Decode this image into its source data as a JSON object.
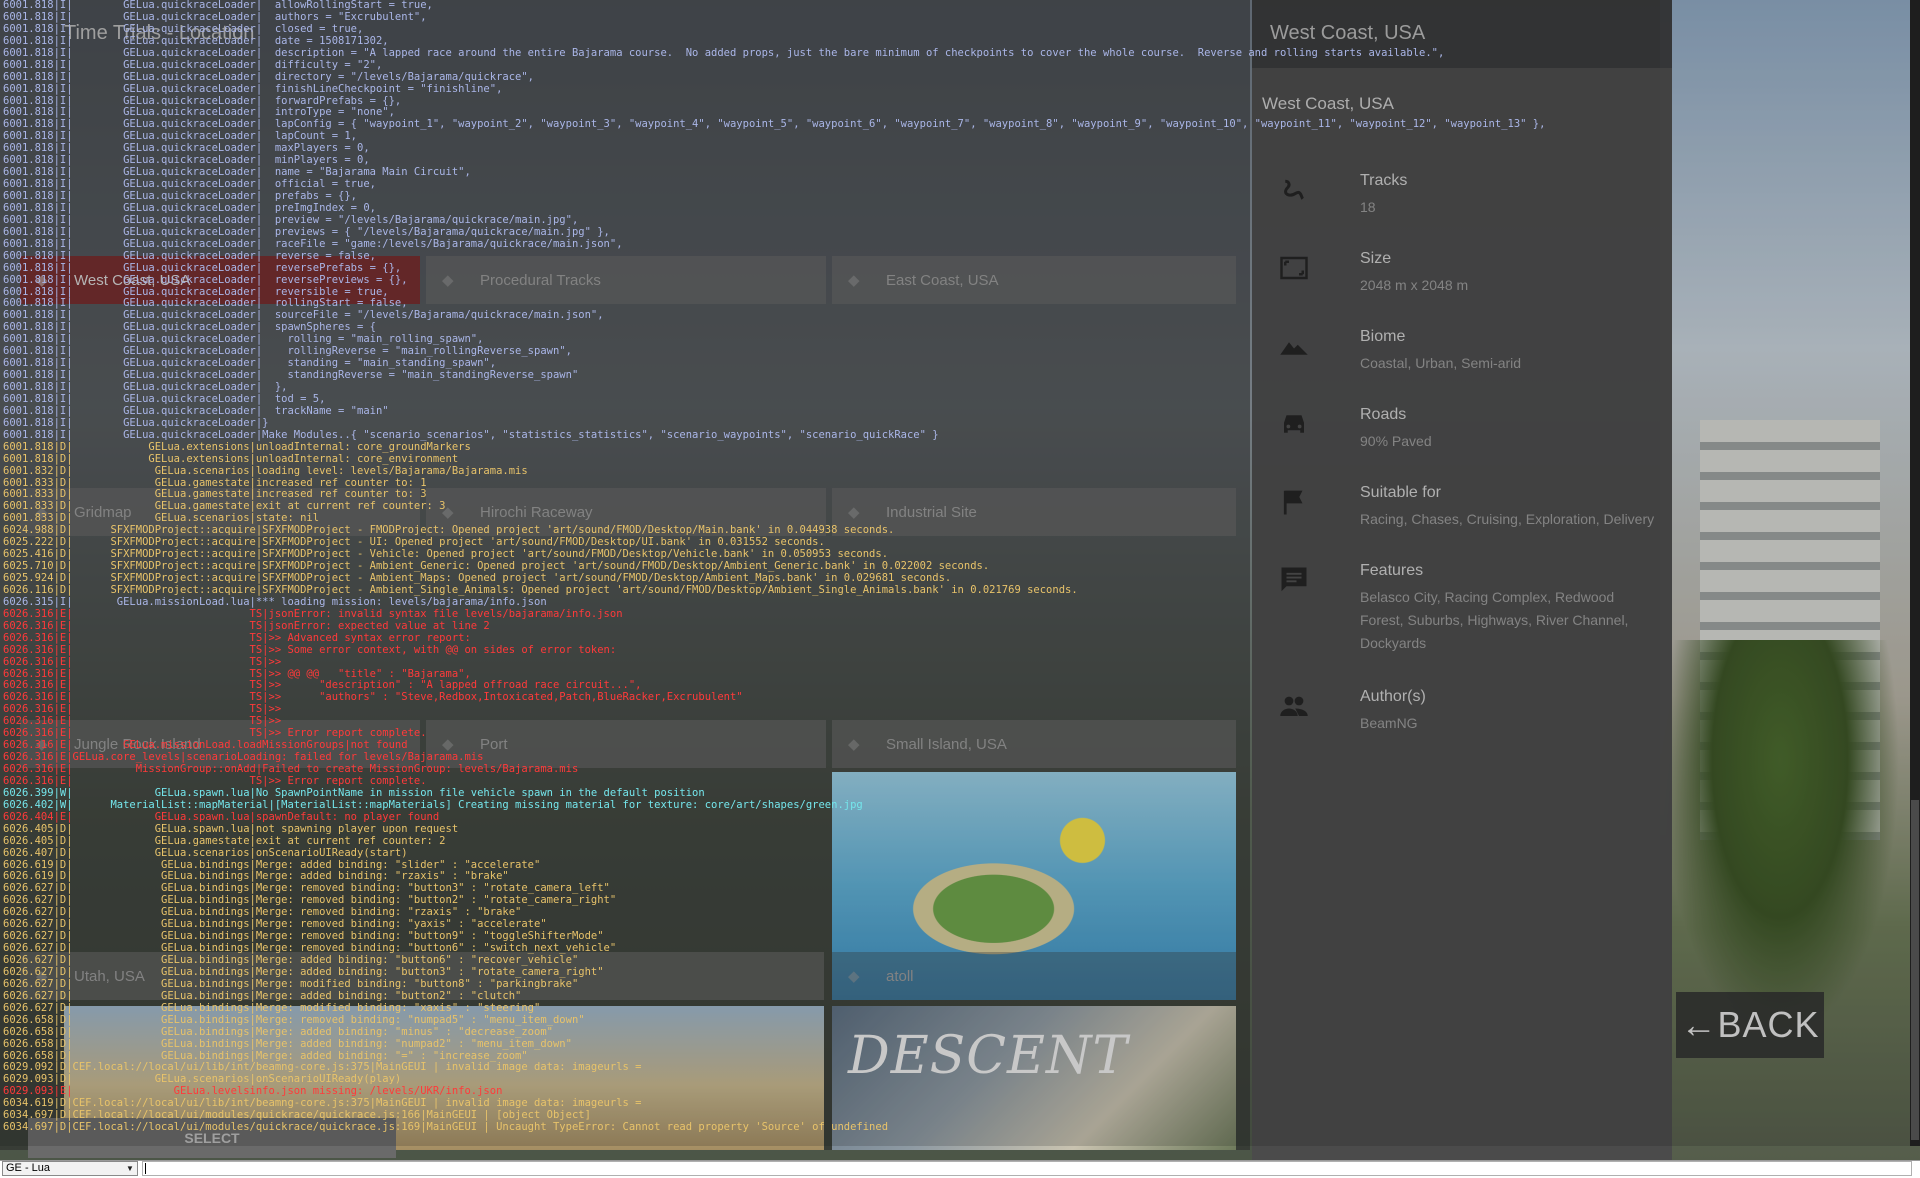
{
  "menu": {
    "heading": "Time Trials - Location",
    "tiles": [
      {
        "label": "West Coast, USA",
        "selected": true
      },
      {
        "label": "Procedural Tracks"
      },
      {
        "label": "East Coast, USA"
      },
      {
        "label": "Gridmap"
      },
      {
        "label": "Hirochi Raceway"
      },
      {
        "label": "Industrial Site"
      },
      {
        "label": "Jungle Rock Island"
      },
      {
        "label": "Port"
      },
      {
        "label": "Small Island, USA"
      },
      {
        "label": "Utah, USA"
      },
      {
        "label": "atoll"
      }
    ],
    "descent_art_text": "DESCENT"
  },
  "info_panel": {
    "header": "West Coast, USA",
    "card_title": "West Coast, USA",
    "specs": [
      {
        "icon": "track-squiggle-icon",
        "title": "Tracks",
        "value": "18"
      },
      {
        "icon": "map-size-icon",
        "title": "Size",
        "value": "2048 m x 2048 m"
      },
      {
        "icon": "mountain-icon",
        "title": "Biome",
        "value": "Coastal, Urban, Semi-arid"
      },
      {
        "icon": "car-icon",
        "title": "Roads",
        "value": "90% Paved"
      },
      {
        "icon": "flag-icon",
        "title": "Suitable for",
        "value": "Racing, Chases, Cruising, Exploration, Delivery"
      },
      {
        "icon": "comment-icon",
        "title": "Features",
        "value": "Belasco City, Racing Complex, Redwood Forest, Suburbs, Highways, River Channel, Dockyards"
      },
      {
        "icon": "people-icon",
        "title": "Author(s)",
        "value": "BeamNG"
      }
    ],
    "select_label": "SELECT"
  },
  "back_button": "←BACK",
  "console": {
    "context_selector": "GE - Lua",
    "command_placeholder": "",
    "lines": [
      {
        "level": "I",
        "text": "6001.818|I|        GELua.quickraceLoader|  allowRollingStart = true,"
      },
      {
        "level": "I",
        "text": "6001.818|I|        GELua.quickraceLoader|  authors = \"Excrubulent\","
      },
      {
        "level": "I",
        "text": "6001.818|I|        GELua.quickraceLoader|  closed = true,"
      },
      {
        "level": "I",
        "text": "6001.818|I|        GELua.quickraceLoader|  date = 1508171302,"
      },
      {
        "level": "I",
        "text": "6001.818|I|        GELua.quickraceLoader|  description = \"A lapped race around the entire Bajarama course.  No added props, just the bare minimum of checkpoints to cover the whole course.  Reverse and rolling starts available.\","
      },
      {
        "level": "I",
        "text": "6001.818|I|        GELua.quickraceLoader|  difficulty = \"2\","
      },
      {
        "level": "I",
        "text": "6001.818|I|        GELua.quickraceLoader|  directory = \"/levels/Bajarama/quickrace\","
      },
      {
        "level": "I",
        "text": "6001.818|I|        GELua.quickraceLoader|  finishLineCheckpoint = \"finishline\","
      },
      {
        "level": "I",
        "text": "6001.818|I|        GELua.quickraceLoader|  forwardPrefabs = {},"
      },
      {
        "level": "I",
        "text": "6001.818|I|        GELua.quickraceLoader|  introType = \"none\","
      },
      {
        "level": "I",
        "text": "6001.818|I|        GELua.quickraceLoader|  lapConfig = { \"waypoint_1\", \"waypoint_2\", \"waypoint_3\", \"waypoint_4\", \"waypoint_5\", \"waypoint_6\", \"waypoint_7\", \"waypoint_8\", \"waypoint_9\", \"waypoint_10\", \"waypoint_11\", \"waypoint_12\", \"waypoint_13\" },"
      },
      {
        "level": "I",
        "text": "6001.818|I|        GELua.quickraceLoader|  lapCount = 1,"
      },
      {
        "level": "I",
        "text": "6001.818|I|        GELua.quickraceLoader|  maxPlayers = 0,"
      },
      {
        "level": "I",
        "text": "6001.818|I|        GELua.quickraceLoader|  minPlayers = 0,"
      },
      {
        "level": "I",
        "text": "6001.818|I|        GELua.quickraceLoader|  name = \"Bajarama Main Circuit\","
      },
      {
        "level": "I",
        "text": "6001.818|I|        GELua.quickraceLoader|  official = true,"
      },
      {
        "level": "I",
        "text": "6001.818|I|        GELua.quickraceLoader|  prefabs = {},"
      },
      {
        "level": "I",
        "text": "6001.818|I|        GELua.quickraceLoader|  preImgIndex = 0,"
      },
      {
        "level": "I",
        "text": "6001.818|I|        GELua.quickraceLoader|  preview = \"/levels/Bajarama/quickrace/main.jpg\","
      },
      {
        "level": "I",
        "text": "6001.818|I|        GELua.quickraceLoader|  previews = { \"/levels/Bajarama/quickrace/main.jpg\" },"
      },
      {
        "level": "I",
        "text": "6001.818|I|        GELua.quickraceLoader|  raceFile = \"game:/levels/Bajarama/quickrace/main.json\","
      },
      {
        "level": "I",
        "text": "6001.818|I|        GELua.quickraceLoader|  reverse = false,"
      },
      {
        "level": "I",
        "text": "6001.818|I|        GELua.quickraceLoader|  reversePrefabs = {},"
      },
      {
        "level": "I",
        "text": "6001.818|I|        GELua.quickraceLoader|  reversePreviews = {},"
      },
      {
        "level": "I",
        "text": "6001.818|I|        GELua.quickraceLoader|  reversible = true,"
      },
      {
        "level": "I",
        "text": "6001.818|I|        GELua.quickraceLoader|  rollingStart = false,"
      },
      {
        "level": "I",
        "text": "6001.818|I|        GELua.quickraceLoader|  sourceFile = \"/levels/Bajarama/quickrace/main.json\","
      },
      {
        "level": "I",
        "text": "6001.818|I|        GELua.quickraceLoader|  spawnSpheres = {"
      },
      {
        "level": "I",
        "text": "6001.818|I|        GELua.quickraceLoader|    rolling = \"main_rolling_spawn\","
      },
      {
        "level": "I",
        "text": "6001.818|I|        GELua.quickraceLoader|    rollingReverse = \"main_rollingReverse_spawn\","
      },
      {
        "level": "I",
        "text": "6001.818|I|        GELua.quickraceLoader|    standing = \"main_standing_spawn\","
      },
      {
        "level": "I",
        "text": "6001.818|I|        GELua.quickraceLoader|    standingReverse = \"main_standingReverse_spawn\""
      },
      {
        "level": "I",
        "text": "6001.818|I|        GELua.quickraceLoader|  },"
      },
      {
        "level": "I",
        "text": "6001.818|I|        GELua.quickraceLoader|  tod = 5,"
      },
      {
        "level": "I",
        "text": "6001.818|I|        GELua.quickraceLoader|  trackName = \"main\""
      },
      {
        "level": "I",
        "text": "6001.818|I|        GELua.quickraceLoader|}"
      },
      {
        "level": "I",
        "text": "6001.818|I|        GELua.quickraceLoader|Make Modules..{ \"scenario_scenarios\", \"statistics_statistics\", \"scenario_waypoints\", \"scenario_quickRace\" }"
      },
      {
        "level": "D",
        "text": "6001.818|D|            GELua.extensions|unloadInternal: core_groundMarkers"
      },
      {
        "level": "D",
        "text": "6001.818|D|            GELua.extensions|unloadInternal: core_environment"
      },
      {
        "level": "D",
        "text": "6001.832|D|             GELua.scenarios|loading level: levels/Bajarama/Bajarama.mis"
      },
      {
        "level": "D",
        "text": "6001.833|D|             GELua.gamestate|increased ref counter to: 1"
      },
      {
        "level": "D",
        "text": "6001.833|D|             GELua.gamestate|increased ref counter to: 3"
      },
      {
        "level": "D",
        "text": "6001.833|D|             GELua.gamestate|exit at current ref counter: 3"
      },
      {
        "level": "D",
        "text": "6001.833|D|             GELua.scenarios|state: nil"
      },
      {
        "level": "D",
        "text": "6024.988|D|      SFXFMODProject::acquire|SFXFMODProject - FMODProject: Opened project 'art/sound/FMOD/Desktop/Main.bank' in 0.044938 seconds."
      },
      {
        "level": "D",
        "text": "6025.222|D|      SFXFMODProject::acquire|SFXFMODProject - UI: Opened project 'art/sound/FMOD/Desktop/UI.bank' in 0.031552 seconds."
      },
      {
        "level": "D",
        "text": "6025.416|D|      SFXFMODProject::acquire|SFXFMODProject - Vehicle: Opened project 'art/sound/FMOD/Desktop/Vehicle.bank' in 0.050953 seconds."
      },
      {
        "level": "D",
        "text": "6025.710|D|      SFXFMODProject::acquire|SFXFMODProject - Ambient_Generic: Opened project 'art/sound/FMOD/Desktop/Ambient_Generic.bank' in 0.022002 seconds."
      },
      {
        "level": "D",
        "text": "6025.924|D|      SFXFMODProject::acquire|SFXFMODProject - Ambient_Maps: Opened project 'art/sound/FMOD/Desktop/Ambient_Maps.bank' in 0.029681 seconds."
      },
      {
        "level": "D",
        "text": "6026.116|D|      SFXFMODProject::acquire|SFXFMODProject - Ambient_Single_Animals: Opened project 'art/sound/FMOD/Desktop/Ambient_Single_Animals.bank' in 0.021769 seconds."
      },
      {
        "level": "I",
        "text": "6026.315|I|       GELua.missionLoad.lua|*** loading mission: levels/bajarama/info.json"
      },
      {
        "level": "E",
        "text": "6026.316|E|                            TS|jsonError: invalid syntax file levels/bajarama/info.json"
      },
      {
        "level": "E",
        "text": "6026.316|E|                            TS|jsonError: expected value at line 2"
      },
      {
        "level": "E",
        "text": "6026.316|E|                            TS|>> Advanced syntax error report:"
      },
      {
        "level": "E",
        "text": "6026.316|E|                            TS|>> Some error context, with @@ on sides of error token:"
      },
      {
        "level": "E",
        "text": "6026.316|E|                            TS|>>"
      },
      {
        "level": "E",
        "text": "6026.316|E|                            TS|>> @@ @@   \"title\" : \"Bajarama\","
      },
      {
        "level": "E",
        "text": "6026.316|E|                            TS|>>      \"description\" : \"A lapped offroad race circuit...\","
      },
      {
        "level": "E",
        "text": "6026.316|E|                            TS|>>      \"authors\" : \"Steve,Redbox,Intoxicated,Patch,BlueRacker,Excrubulent\""
      },
      {
        "level": "E",
        "text": "6026.316|E|                            TS|>>"
      },
      {
        "level": "E",
        "text": "6026.316|E|                            TS|>>"
      },
      {
        "level": "E",
        "text": "6026.316|E|                            TS|>> Error report complete."
      },
      {
        "level": "E",
        "text": "6026.316|E|        GELua.missionLoad.loadMissionGroups|not found"
      },
      {
        "level": "E",
        "text": "6026.316|E|GELua.core_levels|scenarioLoading: failed for levels/Bajarama.mis"
      },
      {
        "level": "E",
        "text": "6026.316|E|          MissionGroup::onAdd|Failed to create MissionGroup: levels/Bajarama.mis"
      },
      {
        "level": "E",
        "text": "6026.316|E|                            TS|>> Error report complete."
      },
      {
        "level": "W",
        "text": "6026.399|W|             GELua.spawn.lua|No SpawnPointName in mission file vehicle spawn in the default position"
      },
      {
        "level": "W",
        "text": "6026.402|W|      MaterialList::mapMaterial|[MaterialList::mapMaterials] Creating missing material for texture: core/art/shapes/green.jpg"
      },
      {
        "level": "E",
        "text": "6026.404|E|             GELua.spawn.lua|spawnDefault: no player found"
      },
      {
        "level": "D",
        "text": "6026.405|D|             GELua.spawn.lua|not spawning player upon request"
      },
      {
        "level": "D",
        "text": "6026.405|D|             GELua.gamestate|exit at current ref counter: 2"
      },
      {
        "level": "D",
        "text": "6026.407|D|             GELua.scenarios|onScenarioUIReady(start)"
      },
      {
        "level": "D",
        "text": "6026.619|D|              GELua.bindings|Merge: added binding: \"slider\" : \"accelerate\""
      },
      {
        "level": "D",
        "text": "6026.619|D|              GELua.bindings|Merge: added binding: \"rzaxis\" : \"brake\""
      },
      {
        "level": "D",
        "text": "6026.627|D|              GELua.bindings|Merge: removed binding: \"button3\" : \"rotate_camera_left\""
      },
      {
        "level": "D",
        "text": "6026.627|D|              GELua.bindings|Merge: removed binding: \"button2\" : \"rotate_camera_right\""
      },
      {
        "level": "D",
        "text": "6026.627|D|              GELua.bindings|Merge: removed binding: \"rzaxis\" : \"brake\""
      },
      {
        "level": "D",
        "text": "6026.627|D|              GELua.bindings|Merge: removed binding: \"yaxis\" : \"accelerate\""
      },
      {
        "level": "D",
        "text": "6026.627|D|              GELua.bindings|Merge: removed binding: \"button9\" : \"toggleShifterMode\""
      },
      {
        "level": "D",
        "text": "6026.627|D|              GELua.bindings|Merge: removed binding: \"button6\" : \"switch_next_vehicle\""
      },
      {
        "level": "D",
        "text": "6026.627|D|              GELua.bindings|Merge: added binding: \"button6\" : \"recover_vehicle\""
      },
      {
        "level": "D",
        "text": "6026.627|D|              GELua.bindings|Merge: added binding: \"button3\" : \"rotate_camera_right\""
      },
      {
        "level": "D",
        "text": "6026.627|D|              GELua.bindings|Merge: modified binding: \"button8\" : \"parkingbrake\""
      },
      {
        "level": "D",
        "text": "6026.627|D|              GELua.bindings|Merge: added binding: \"button2\" : \"clutch\""
      },
      {
        "level": "D",
        "text": "6026.627|D|              GELua.bindings|Merge: modified binding: \"xaxis\" : \"steering\""
      },
      {
        "level": "D",
        "text": "6026.658|D|              GELua.bindings|Merge: removed binding: \"numpad5\" : \"menu_item_down\""
      },
      {
        "level": "D",
        "text": "6026.658|D|              GELua.bindings|Merge: added binding: \"minus\" : \"decrease_zoom\""
      },
      {
        "level": "D",
        "text": "6026.658|D|              GELua.bindings|Merge: added binding: \"numpad2\" : \"menu_item_down\""
      },
      {
        "level": "D",
        "text": "6026.658|D|              GELua.bindings|Merge: added binding: \"=\" : \"increase_zoom\""
      },
      {
        "level": "D",
        "text": "6029.092|D|CEF.local://local/ui/lib/int/beamng-core.js:375|MainGEUI | invalid image data: imageurls ="
      },
      {
        "level": "D",
        "text": "6029.093|D|             GELua.scenarios|onScenarioUIReady(play)"
      },
      {
        "level": "E",
        "text": "6029.093|E|                GELua.levelsinfo.json missing: /levels/UKR/info.json"
      },
      {
        "level": "D",
        "text": "6034.619|D|CEF.local://local/ui/lib/int/beamng-core.js:375|MainGEUI | invalid image data: imageurls ="
      },
      {
        "level": "D",
        "text": "6034.697|D|CEF.local://local/ui/modules/quickrace/quickrace.js:166|MainGEUI | [object Object]"
      },
      {
        "level": "D",
        "text": "6034.697|D|CEF.local://local/ui/modules/quickrace/quickrace.js:169|MainGEUI | Uncaught TypeError: Cannot read property 'Source' of undefined"
      }
    ]
  }
}
